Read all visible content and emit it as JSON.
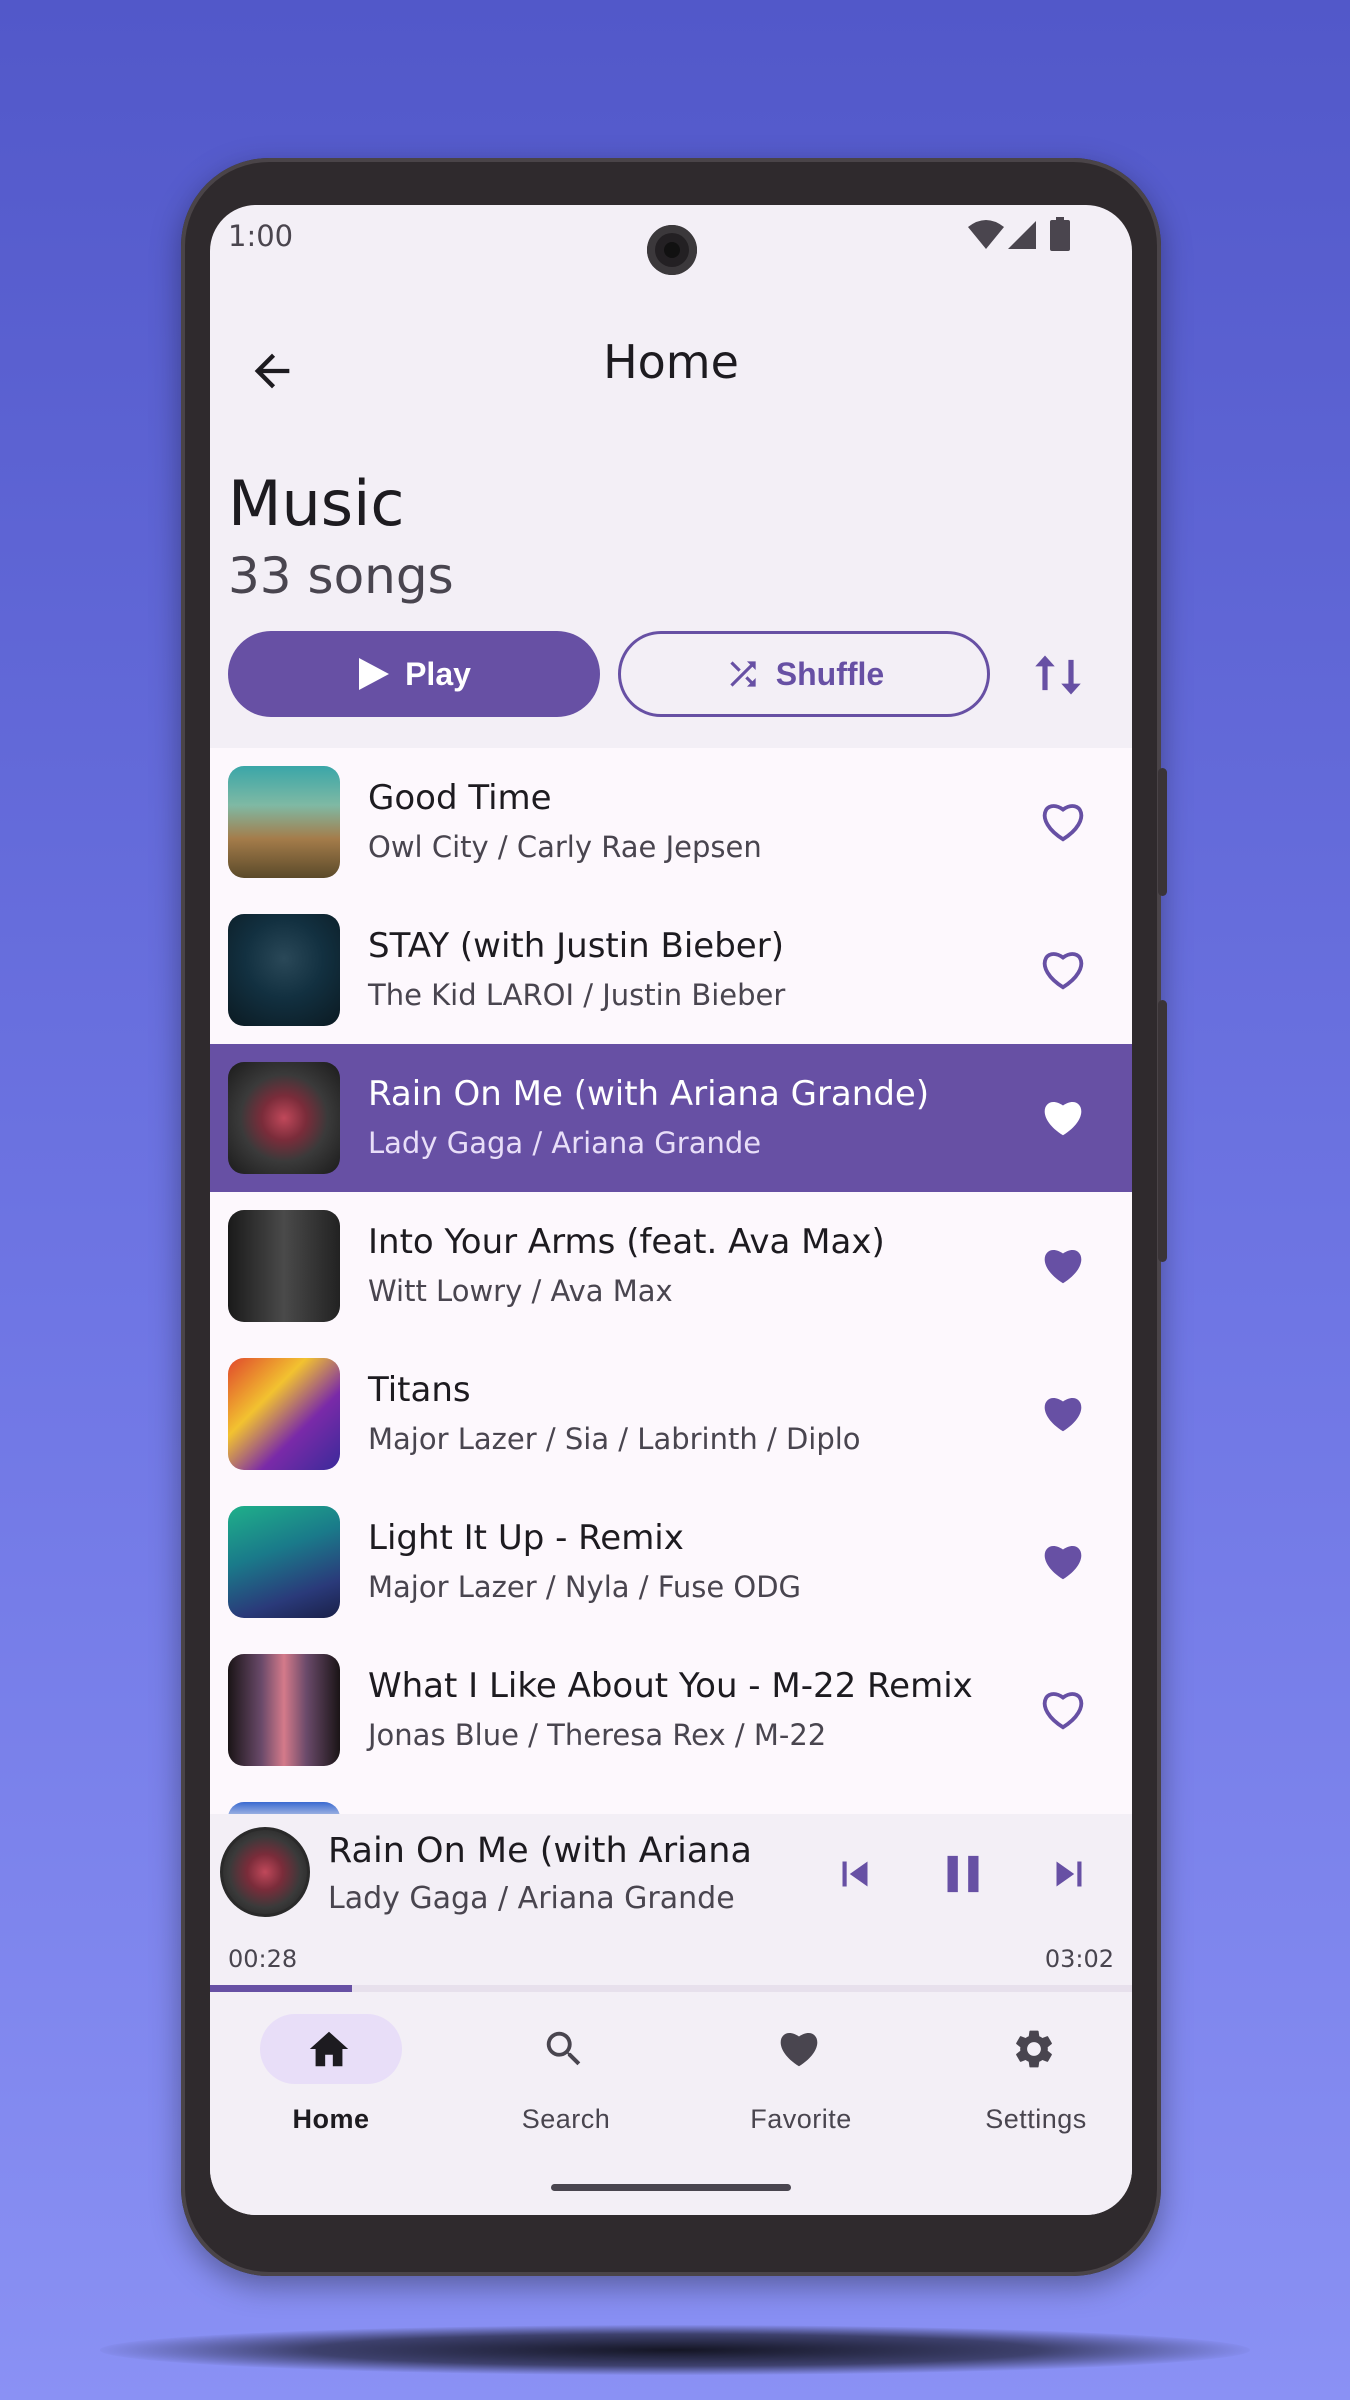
{
  "status_bar": {
    "time": "1:00",
    "icons": [
      "wifi-icon",
      "signal-icon",
      "battery-icon"
    ]
  },
  "app_bar": {
    "title": "Home",
    "back_icon": "arrow-back-icon"
  },
  "header": {
    "title": "Music",
    "count": "33 songs"
  },
  "actions": {
    "play_label": "Play",
    "shuffle_label": "Shuffle",
    "sort_icon": "sort-icon"
  },
  "colors": {
    "primary": "#6750a4",
    "surface": "#f3eff6",
    "list_bg": "#fdf8fd",
    "pill": "#e8def8"
  },
  "songs": [
    {
      "title": "Good Time",
      "artist": "Owl City / Carly Rae Jepsen",
      "favorite": false,
      "active": false
    },
    {
      "title": "STAY (with Justin Bieber)",
      "artist": "The Kid LAROI / Justin Bieber",
      "favorite": false,
      "active": false
    },
    {
      "title": "Rain On Me (with Ariana Grande)",
      "artist": "Lady Gaga / Ariana Grande",
      "favorite": true,
      "active": true
    },
    {
      "title": "Into Your Arms (feat. Ava Max)",
      "artist": "Witt Lowry / Ava Max",
      "favorite": true,
      "active": false
    },
    {
      "title": "Titans",
      "artist": "Major Lazer / Sia / Labrinth / Diplo",
      "favorite": true,
      "active": false
    },
    {
      "title": "Light It Up - Remix",
      "artist": "Major Lazer / Nyla / Fuse ODG",
      "favorite": true,
      "active": false
    },
    {
      "title": "What I Like About You - M-22 Remix",
      "artist": "Jonas Blue / Theresa Rex / M-22",
      "favorite": false,
      "active": false
    }
  ],
  "now_playing": {
    "title": "Rain On Me (with Ariana",
    "artist": "Lady Gaga / Ariana Grande",
    "elapsed": "00:28",
    "duration": "03:02",
    "progress_fraction": 0.154,
    "controls": [
      "skip-previous-icon",
      "pause-icon",
      "skip-next-icon"
    ]
  },
  "nav": [
    {
      "label": "Home",
      "icon": "home-icon",
      "active": true
    },
    {
      "label": "Search",
      "icon": "search-icon",
      "active": false
    },
    {
      "label": "Favorite",
      "icon": "heart-icon",
      "active": false
    },
    {
      "label": "Settings",
      "icon": "gear-icon",
      "active": false
    }
  ]
}
